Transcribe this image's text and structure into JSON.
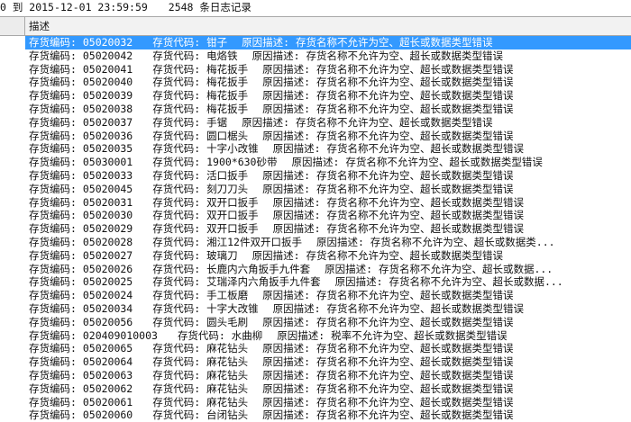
{
  "header": {
    "range_text": "0 到 2015-12-01 23:59:59",
    "count_text": "2548 条日志记录"
  },
  "grid": {
    "column_label": "描述",
    "selected_index": 0,
    "rows": [
      {
        "code": "存货编码: 05020032",
        "name": "存货代码: 钳子",
        "reason": "原因描述: 存货名称不允许为空、超长或数据类型错误"
      },
      {
        "code": "存货编码: 05020042",
        "name": "存货代码: 电烙铁",
        "reason": "原因描述: 存货名称不允许为空、超长或数据类型错误"
      },
      {
        "code": "存货编码: 05020041",
        "name": "存货代码: 梅花扳手",
        "reason": "原因描述: 存货名称不允许为空、超长或数据类型错误"
      },
      {
        "code": "存货编码: 05020040",
        "name": "存货代码: 梅花扳手",
        "reason": "原因描述: 存货名称不允许为空、超长或数据类型错误"
      },
      {
        "code": "存货编码: 05020039",
        "name": "存货代码: 梅花扳手",
        "reason": "原因描述: 存货名称不允许为空、超长或数据类型错误"
      },
      {
        "code": "存货编码: 05020038",
        "name": "存货代码: 梅花扳手",
        "reason": "原因描述: 存货名称不允许为空、超长或数据类型错误"
      },
      {
        "code": "存货编码: 05020037",
        "name": "存货代码: 手锯",
        "reason": "原因描述: 存货名称不允许为空、超长或数据类型错误"
      },
      {
        "code": "存货编码: 05020036",
        "name": "存货代码: 圆口椐头",
        "reason": "原因描述: 存货名称不允许为空、超长或数据类型错误"
      },
      {
        "code": "存货编码: 05020035",
        "name": "存货代码: 十字小改锥",
        "reason": "原因描述: 存货名称不允许为空、超长或数据类型错误"
      },
      {
        "code": "存货编码: 05030001",
        "name": "存货代码: 1900*630砂带",
        "reason": "原因描述: 存货名称不允许为空、超长或数据类型错误"
      },
      {
        "code": "存货编码: 05020033",
        "name": "存货代码: 活口扳手",
        "reason": "原因描述: 存货名称不允许为空、超长或数据类型错误"
      },
      {
        "code": "存货编码: 05020045",
        "name": "存货代码: 刻刀刀头",
        "reason": "原因描述: 存货名称不允许为空、超长或数据类型错误"
      },
      {
        "code": "存货编码: 05020031",
        "name": "存货代码: 双开口扳手",
        "reason": "原因描述: 存货名称不允许为空、超长或数据类型错误"
      },
      {
        "code": "存货编码: 05020030",
        "name": "存货代码: 双开口扳手",
        "reason": "原因描述: 存货名称不允许为空、超长或数据类型错误"
      },
      {
        "code": "存货编码: 05020029",
        "name": "存货代码: 双开口扳手",
        "reason": "原因描述: 存货名称不允许为空、超长或数据类型错误"
      },
      {
        "code": "存货编码: 05020028",
        "name": "存货代码: 湘江12件双开口扳手",
        "reason": "原因描述: 存货名称不允许为空、超长或数据类..."
      },
      {
        "code": "存货编码: 05020027",
        "name": "存货代码: 玻璃刀",
        "reason": "原因描述: 存货名称不允许为空、超长或数据类型错误"
      },
      {
        "code": "存货编码: 05020026",
        "name": "存货代码: 长鹿内六角扳手九件套",
        "reason": "原因描述: 存货名称不允许为空、超长或数据..."
      },
      {
        "code": "存货编码: 05020025",
        "name": "存货代码: 艾瑞泽内六角扳手九件套",
        "reason": "原因描述: 存货名称不允许为空、超长或数据..."
      },
      {
        "code": "存货编码: 05020024",
        "name": "存货代码: 手工板磨",
        "reason": "原因描述: 存货名称不允许为空、超长或数据类型错误"
      },
      {
        "code": "存货编码: 05020034",
        "name": "存货代码: 十字大改锥",
        "reason": "原因描述: 存货名称不允许为空、超长或数据类型错误"
      },
      {
        "code": "存货编码: 05020056",
        "name": "存货代码: 圆头毛刷",
        "reason": "原因描述: 存货名称不允许为空、超长或数据类型错误"
      },
      {
        "code": "存货编码: 020409010003",
        "name": "存货代码: 水曲柳",
        "reason": "原因描述: 税率不允许为空、超长或数据类型错误"
      },
      {
        "code": "存货编码: 05020065",
        "name": "存货代码: 麻花钻头",
        "reason": "原因描述: 存货名称不允许为空、超长或数据类型错误"
      },
      {
        "code": "存货编码: 05020064",
        "name": "存货代码: 麻花钻头",
        "reason": "原因描述: 存货名称不允许为空、超长或数据类型错误"
      },
      {
        "code": "存货编码: 05020063",
        "name": "存货代码: 麻花钻头",
        "reason": "原因描述: 存货名称不允许为空、超长或数据类型错误"
      },
      {
        "code": "存货编码: 05020062",
        "name": "存货代码: 麻花钻头",
        "reason": "原因描述: 存货名称不允许为空、超长或数据类型错误"
      },
      {
        "code": "存货编码: 05020061",
        "name": "存货代码: 麻花钻头",
        "reason": "原因描述: 存货名称不允许为空、超长或数据类型错误"
      },
      {
        "code": "存货编码: 05020060",
        "name": "存货代码: 台闭钻头",
        "reason": "原因描述: 存货名称不允许为空、超长或数据类型错误"
      }
    ]
  }
}
